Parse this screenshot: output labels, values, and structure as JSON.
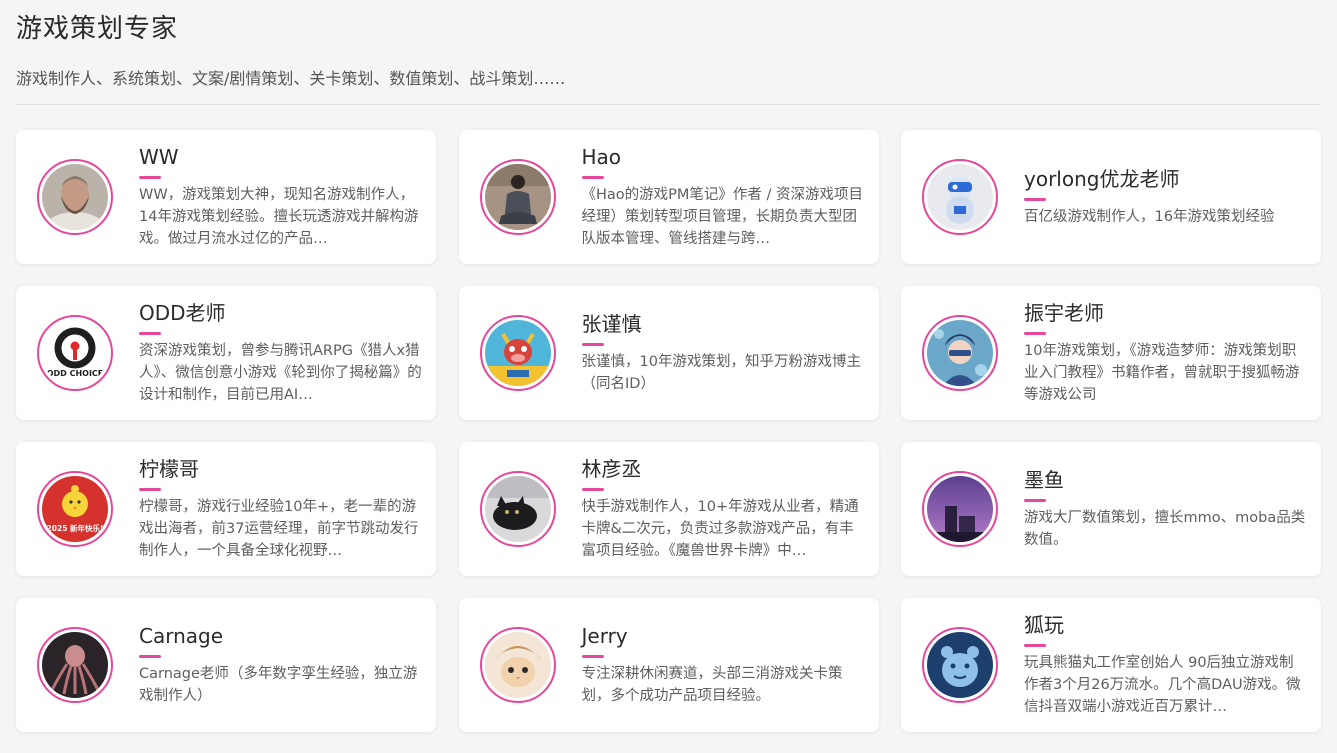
{
  "header": {
    "title": "游戏策划专家",
    "subtitle": "游戏制作人、系统策划、文案/剧情策划、关卡策划、数值策划、战斗策划……"
  },
  "colors": {
    "accent": "#e5489a",
    "background": "#f5f5f6",
    "card": "#ffffff"
  },
  "experts": [
    {
      "name": "WW",
      "desc": "WW，游戏策划大神，现知名游戏制作人，14年游戏策划经验。擅长玩透游戏并解构游戏。做过月流水过亿的产品…",
      "avatar": "bearded-man-photo"
    },
    {
      "name": "Hao",
      "desc": "《Hao的游戏PM笔记》作者 / 资深游戏项目经理）策划转型项目管理，长期负责大型团队版本管理、管线搭建与跨…",
      "avatar": "seated-person-photo"
    },
    {
      "name": "yorlong优龙老师",
      "desc": "百亿级游戏制作人，16年游戏策划经验",
      "avatar": "toy-figure-photo"
    },
    {
      "name": "ODD老师",
      "desc": "资深游戏策划，曾参与腾讯ARPG《猎人x猎人》、微信创意小游戏《轮到你了揭秘篇》的设计和制作，目前已用AI…",
      "avatar": "odd-choice-logo",
      "avatar_text": "ODD CHOICE"
    },
    {
      "name": "张谨慎",
      "desc": "张谨慎，10年游戏策划，知乎万粉游戏博主（同名ID）",
      "avatar": "cartoon-cow-figure"
    },
    {
      "name": "振宇老师",
      "desc": "10年游戏策划，《游戏造梦师：游戏策划职业入门教程》书籍作者，曾就职于搜狐畅游等游戏公司",
      "avatar": "anime-boy-illustration"
    },
    {
      "name": "柠檬哥",
      "desc": "柠檬哥，游戏行业经验10年+，老一辈的游戏出海者，前37运营经理，前字节跳动发行制作人，一个具备全球化视野…",
      "avatar": "chick-new-year-card",
      "avatar_text": "2025 新年快乐!"
    },
    {
      "name": "林彦丞",
      "desc": "快手游戏制作人，10+年游戏从业者，精通卡牌&二次元，负责过多款游戏产品，有丰富项目经验。《魔兽世界卡牌》中…",
      "avatar": "black-cat-photo"
    },
    {
      "name": "墨鱼",
      "desc": "游戏大厂数值策划，擅长mmo、moba品类数值。",
      "avatar": "purple-sky-building"
    },
    {
      "name": "Carnage",
      "desc": "Carnage老师（多年数字孪生经验，独立游戏制作人）",
      "avatar": "dark-octopus-art"
    },
    {
      "name": "Jerry",
      "desc": "专注深耕休闲赛道，头部三消游戏关卡策划，多个成功产品项目经验。",
      "avatar": "kitten-in-hat-photo"
    },
    {
      "name": "狐玩",
      "desc": "玩具熊猫丸工作室创始人 90后独立游戏制作者3个月26万流水。几个高DAU游戏。微信抖音双端小游戏近百万累计…",
      "avatar": "blue-bear-doodle"
    }
  ]
}
